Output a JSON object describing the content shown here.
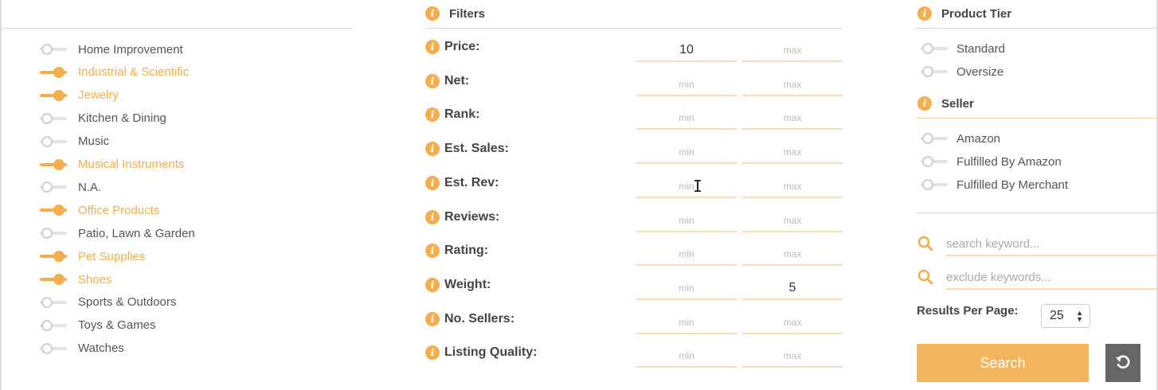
{
  "categories": [
    {
      "label": "Home Improvement",
      "on": false
    },
    {
      "label": "Industrial & Scientific",
      "on": true
    },
    {
      "label": "Jewelry",
      "on": true
    },
    {
      "label": "Kitchen & Dining",
      "on": false
    },
    {
      "label": "Music",
      "on": false
    },
    {
      "label": "Musical Instruments",
      "on": true
    },
    {
      "label": "N.A.",
      "on": false
    },
    {
      "label": "Office Products",
      "on": true
    },
    {
      "label": "Patio, Lawn & Garden",
      "on": false
    },
    {
      "label": "Pet Supplies",
      "on": true
    },
    {
      "label": "Shoes",
      "on": true
    },
    {
      "label": "Sports & Outdoors",
      "on": false
    },
    {
      "label": "Toys & Games",
      "on": false
    },
    {
      "label": "Watches",
      "on": false
    }
  ],
  "filters": {
    "title": "Filters",
    "info_icon": "i",
    "rows": [
      {
        "label": "Price:",
        "min": "10",
        "max": "",
        "min_placeholder": "min",
        "max_placeholder": "max"
      },
      {
        "label": "Net:",
        "min": "",
        "max": "",
        "min_placeholder": "min",
        "max_placeholder": "max"
      },
      {
        "label": "Rank:",
        "min": "",
        "max": "",
        "min_placeholder": "min",
        "max_placeholder": "max"
      },
      {
        "label": "Est. Sales:",
        "min": "",
        "max": "",
        "min_placeholder": "min",
        "max_placeholder": "max"
      },
      {
        "label": "Est. Rev:",
        "min": "",
        "max": "",
        "min_placeholder": "min",
        "max_placeholder": "max"
      },
      {
        "label": "Reviews:",
        "min": "",
        "max": "",
        "min_placeholder": "min",
        "max_placeholder": "max"
      },
      {
        "label": "Rating:",
        "min": "",
        "max": "",
        "min_placeholder": "min",
        "max_placeholder": "max"
      },
      {
        "label": "Weight:",
        "min": "",
        "max": "5",
        "min_placeholder": "min",
        "max_placeholder": "max"
      },
      {
        "label": "No. Sellers:",
        "min": "",
        "max": "",
        "min_placeholder": "min",
        "max_placeholder": "max"
      },
      {
        "label": "Listing Quality:",
        "min": "",
        "max": "",
        "min_placeholder": "min",
        "max_placeholder": "max"
      }
    ]
  },
  "product_tier": {
    "title": "Product Tier",
    "items": [
      {
        "label": "Standard",
        "on": false
      },
      {
        "label": "Oversize",
        "on": false
      }
    ]
  },
  "seller": {
    "title": "Seller",
    "items": [
      {
        "label": "Amazon",
        "on": false
      },
      {
        "label": "Fulfilled By Amazon",
        "on": false
      },
      {
        "label": "Fulfilled By Merchant",
        "on": false
      }
    ]
  },
  "search": {
    "keyword_placeholder": "search keyword...",
    "exclude_placeholder": "exclude keywords...",
    "icon": "search-icon"
  },
  "results_per_page": {
    "label": "Results Per Page:",
    "value": "25",
    "arrows": "▲▼"
  },
  "buttons": {
    "search_label": "Search",
    "reset_icon": "reset-icon"
  },
  "colors": {
    "accent": "#f3ae4e",
    "divider": "#f6d7ad",
    "reset_bg": "#666666"
  },
  "cursor_glyph": "I"
}
